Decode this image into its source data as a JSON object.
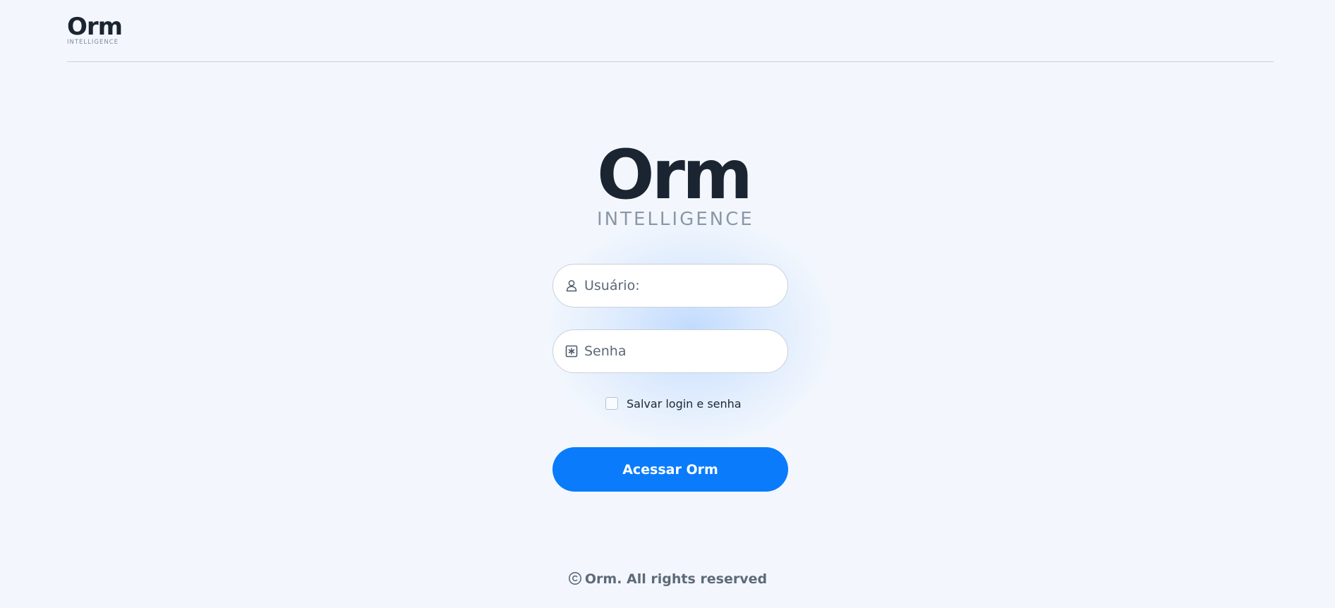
{
  "header": {
    "logo_word": "Orm",
    "logo_sub": "INTELLIGENCE"
  },
  "main_logo": {
    "word": "Orm",
    "sub": "INTELLIGENCE"
  },
  "form": {
    "username": {
      "placeholder": "Usuário:",
      "value": "",
      "icon": "user-icon"
    },
    "password": {
      "placeholder": "Senha",
      "value": "",
      "icon": "asterisk-box-icon"
    },
    "remember": {
      "label": "Salvar login e senha",
      "checked": false
    },
    "submit_label": "Acessar Orm"
  },
  "footer": {
    "text": "Orm. All rights reserved",
    "icon": "copyright-icon"
  },
  "colors": {
    "background": "#f3f7fd",
    "accent": "#0a7cfb",
    "text_dark": "#1b2532",
    "text_muted": "#8b97a6"
  }
}
